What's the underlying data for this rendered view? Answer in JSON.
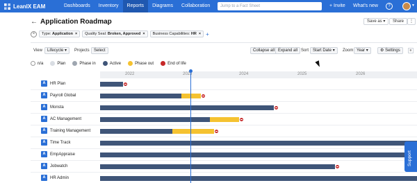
{
  "app": {
    "brand": "LeanIX EAM"
  },
  "nav": {
    "items": [
      "Dashboards",
      "Inventory",
      "Reports",
      "Diagrams",
      "Collaboration"
    ],
    "active_index": 2
  },
  "search": {
    "placeholder": "Jump to a Fact Sheet"
  },
  "top_actions": {
    "invite": "+ Invite",
    "whatsnew": "What's new",
    "help": "?"
  },
  "page": {
    "title": "Application Roadmap",
    "save_as": "Save as",
    "share": "Share"
  },
  "filters": [
    {
      "key": "Type:",
      "value": "Application"
    },
    {
      "key": "Quality Seal:",
      "value": "Broken, Approved"
    },
    {
      "key": "Business Capabilities:",
      "value": "HR"
    }
  ],
  "filters_add": "+",
  "view": {
    "view_label": "View",
    "view_value": "Lifecycle",
    "projects_label": "Projects",
    "projects_value": "Select",
    "collapse_all": "Collapse all",
    "expand_all": "Expand all",
    "sort_label": "Sort",
    "sort_value": "Start Date",
    "zoom_label": "Zoom",
    "zoom_value": "Year",
    "settings": "Settings"
  },
  "legend": [
    {
      "label": "n/a",
      "color": "#ffffff"
    },
    {
      "label": "Plan",
      "color": "#d9dde3"
    },
    {
      "label": "Phase in",
      "color": "#9ea6b0"
    },
    {
      "label": "Active",
      "color": "#3f5578"
    },
    {
      "label": "Phase out",
      "color": "#f5c230"
    },
    {
      "label": "End of life",
      "color": "#c62828"
    }
  ],
  "years": [
    "2022",
    "2023",
    "2024",
    "2025",
    "2026"
  ],
  "rows": [
    {
      "name": "HR Plan",
      "badge": "A"
    },
    {
      "name": "Payroll Global",
      "badge": "A"
    },
    {
      "name": "Monsta",
      "badge": "A"
    },
    {
      "name": "AC Management",
      "badge": "A"
    },
    {
      "name": "Training Management",
      "badge": "A"
    },
    {
      "name": "Time Track",
      "badge": "A"
    },
    {
      "name": "EmpAppraise",
      "badge": "A"
    },
    {
      "name": "Jobwatch",
      "badge": "A"
    },
    {
      "name": "HR Admin",
      "badge": "A"
    }
  ],
  "support": {
    "label": "Support"
  }
}
